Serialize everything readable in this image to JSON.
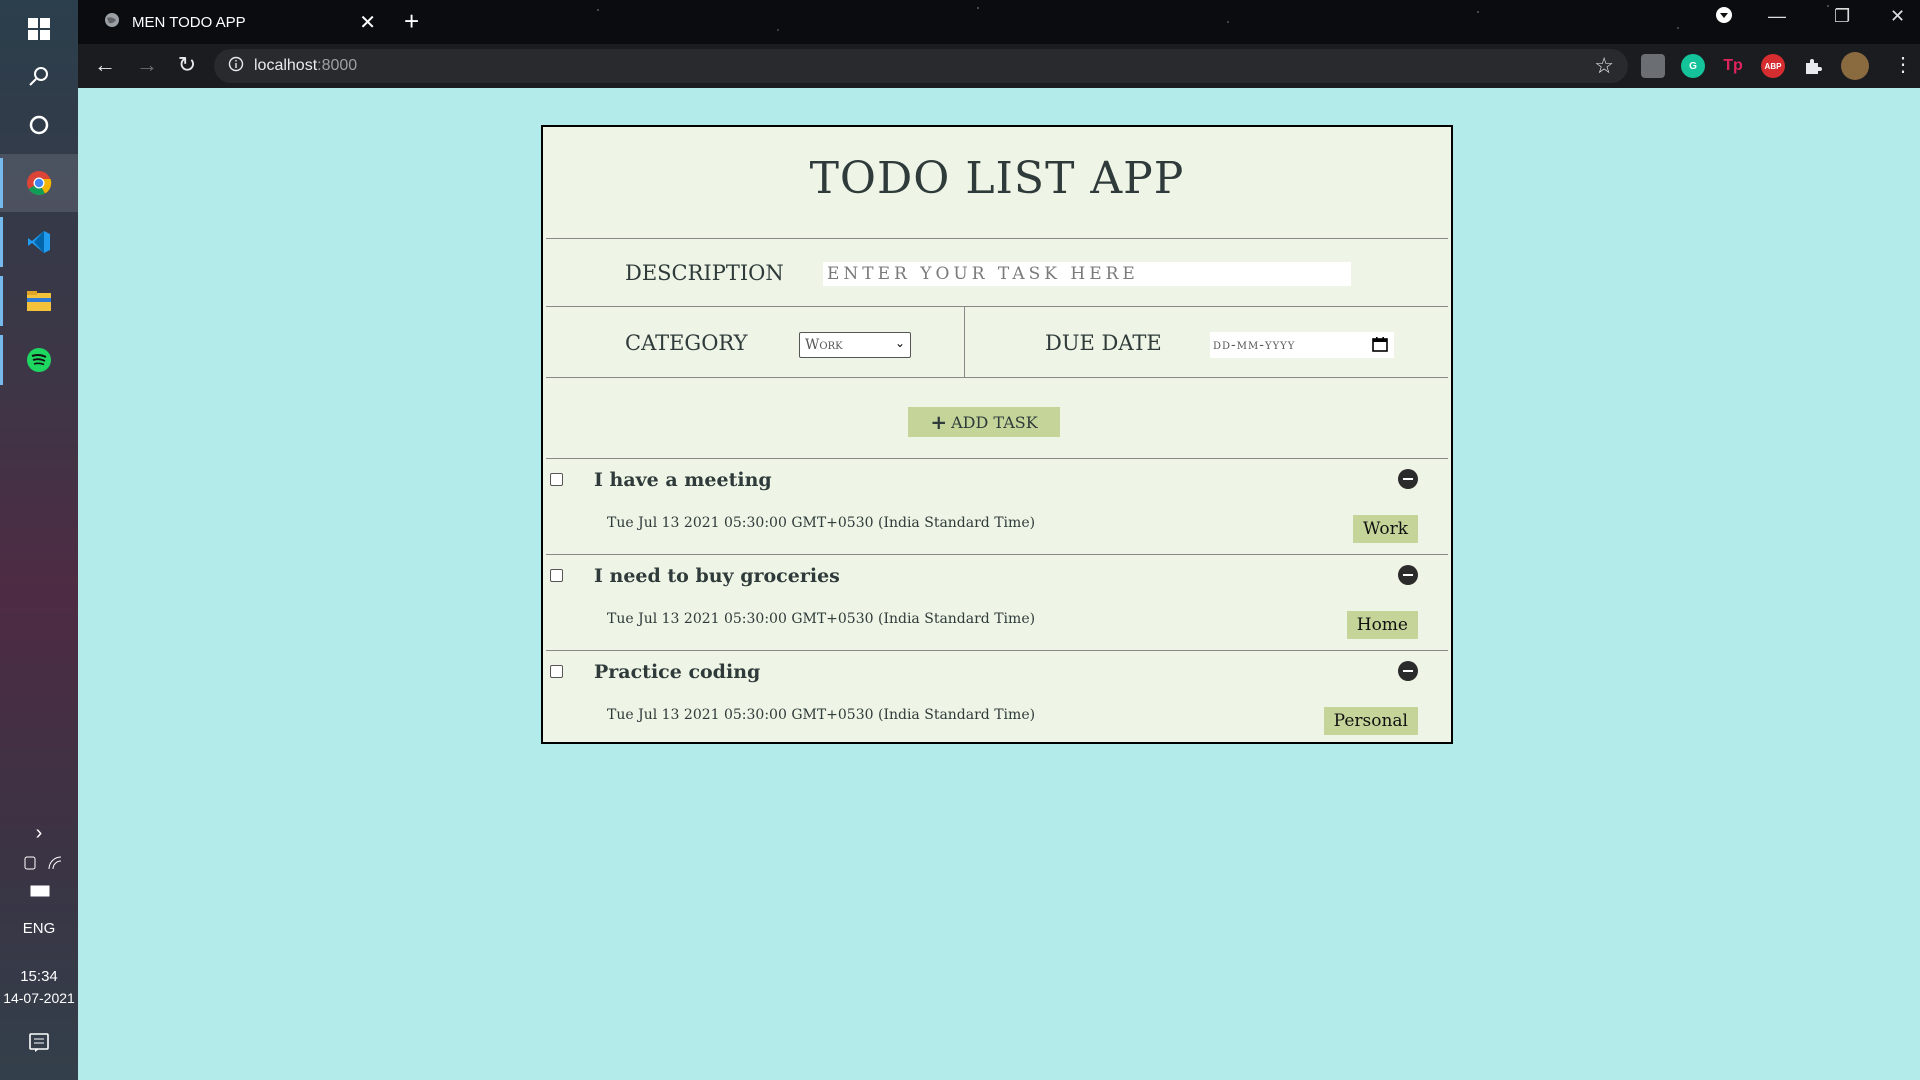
{
  "taskbar": {
    "language": "ENG",
    "time": "15:34",
    "date": "14-07-2021",
    "apps": [
      "chrome-icon",
      "vscode-icon",
      "file-explorer-icon",
      "spotify-icon"
    ]
  },
  "browser": {
    "tab_title": "MEN TODO APP",
    "url_host": "localhost",
    "url_port": ":8000",
    "extensions": [
      "grammarly-icon",
      "tp-icon",
      "adblock-plus-icon",
      "extensions-icon"
    ]
  },
  "app": {
    "title": "TODO LIST APP",
    "description_label": "DESCRIPTION",
    "description_placeholder": "ENTER YOUR TASK HERE",
    "category_label": "CATEGORY",
    "category_value": "Work",
    "due_date_label": "DUE DATE",
    "due_date_placeholder": "dd-mm-yyyy",
    "add_button_label": "ADD TASK",
    "tasks": [
      {
        "name": "I have a meeting",
        "date": "Tue Jul 13 2021 05:30:00 GMT+0530 (India Standard Time)",
        "category": "Work",
        "checked": false
      },
      {
        "name": "I need to buy groceries",
        "date": "Tue Jul 13 2021 05:30:00 GMT+0530 (India Standard Time)",
        "category": "Home",
        "checked": false
      },
      {
        "name": "Practice coding",
        "date": "Tue Jul 13 2021 05:30:00 GMT+0530 (India Standard Time)",
        "category": "Personal",
        "checked": false
      }
    ]
  },
  "colors": {
    "page_bg": "#b3eaea",
    "card_bg": "#eef5e6",
    "accent": "#c5d59a"
  }
}
